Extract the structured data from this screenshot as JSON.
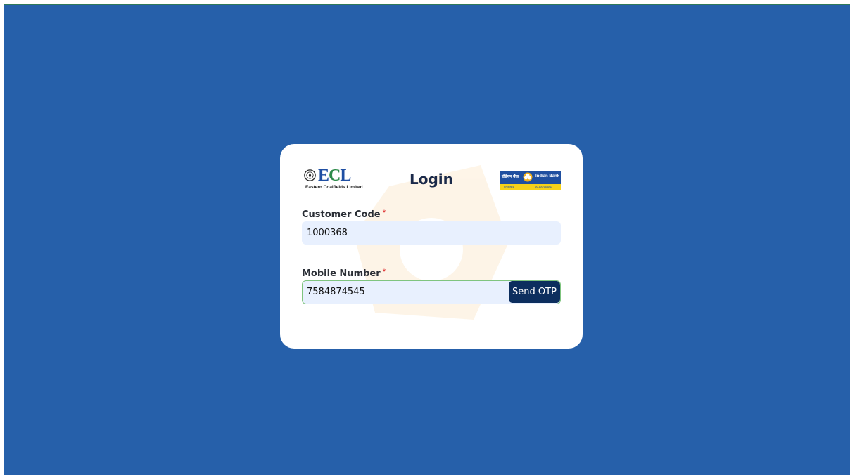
{
  "login": {
    "title": "Login",
    "ecl_logo": {
      "wordmark_e": "E",
      "wordmark_c": "C",
      "wordmark_l": "L",
      "subtitle": "Eastern Coalfields Limited"
    },
    "bank_logo": {
      "hindi_name": "इंडियन बैंक",
      "english_name": "Indian Bank",
      "sub_left": "इलाहाबाद",
      "sub_right": "ALLAHABAD"
    },
    "customer_code": {
      "label": "Customer Code",
      "required_mark": "*",
      "value": "1000368"
    },
    "mobile_number": {
      "label": "Mobile Number",
      "required_mark": "*",
      "value": "7584874545"
    },
    "send_otp_label": "Send OTP"
  },
  "colors": {
    "background": "#2660aa",
    "card": "#ffffff",
    "input_bg": "#e8f0fe",
    "button": "#0c2e5e",
    "title": "#1b2a4a",
    "required": "#e03a3a"
  },
  "icons": {
    "ecl_emblem": "ecl-emblem-icon",
    "bank_emblem": "indian-bank-emblem-icon",
    "watermark": "watermark-logo-icon"
  }
}
